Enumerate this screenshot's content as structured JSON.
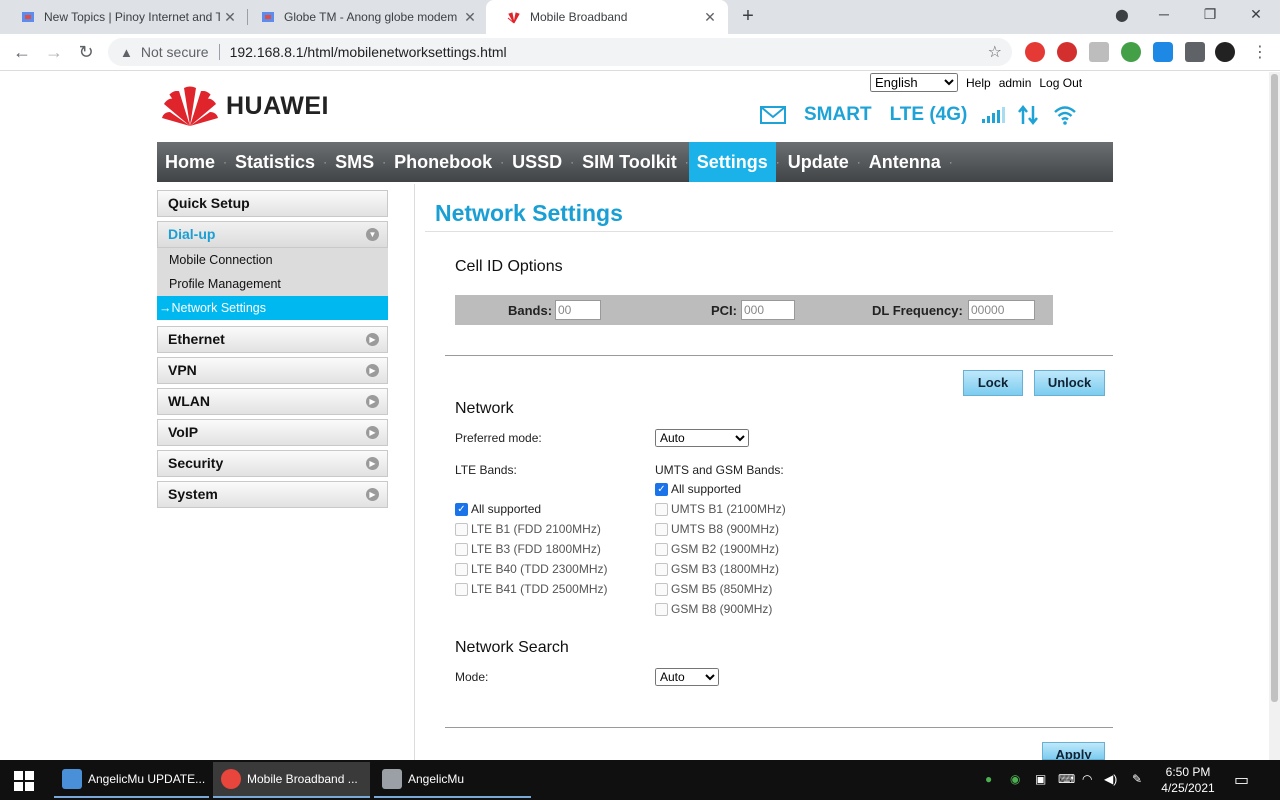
{
  "browser": {
    "tabs": [
      {
        "title": "New Topics | Pinoy Internet and T"
      },
      {
        "title": "Globe TM - Anong globe modem"
      },
      {
        "title": "Mobile Broadband"
      }
    ],
    "address": {
      "security": "Not secure",
      "url": "192.168.8.1/html/mobilenetworksettings.html"
    }
  },
  "header": {
    "language": "English",
    "help": "Help",
    "user": "admin",
    "logout": "Log Out",
    "brand": "HUAWEI",
    "operator": "SMART",
    "network_type": "LTE (4G)"
  },
  "nav": [
    "Home",
    "Statistics",
    "SMS",
    "Phonebook",
    "USSD",
    "SIM Toolkit",
    "Settings",
    "Update",
    "Antenna"
  ],
  "sidebar": {
    "quick_setup": "Quick Setup",
    "dialup": "Dial-up",
    "dialup_items": [
      "Mobile Connection",
      "Profile Management",
      "→Network Settings"
    ],
    "sections": [
      "Ethernet",
      "VPN",
      "WLAN",
      "VoIP",
      "Security",
      "System"
    ]
  },
  "page": {
    "title": "Network Settings",
    "cell_id_title": "Cell ID Options",
    "bands_label": "Bands:",
    "bands_value": "00",
    "pci_label": "PCI:",
    "pci_value": "000",
    "dl_label": "DL Frequency:",
    "dl_value": "00000",
    "lock": "Lock",
    "unlock": "Unlock",
    "network_title": "Network",
    "preferred_label": "Preferred mode:",
    "preferred_value": "Auto",
    "lte_label": "LTE Bands:",
    "umts_label": "UMTS and GSM Bands:",
    "lte_bands": [
      "All supported",
      "LTE B1 (FDD 2100MHz)",
      "LTE B3 (FDD 1800MHz)",
      "LTE B40 (TDD 2300MHz)",
      "LTE B41 (TDD 2500MHz)"
    ],
    "umts_bands": [
      "All supported",
      "UMTS B1 (2100MHz)",
      "UMTS B8 (900MHz)",
      "GSM B2 (1900MHz)",
      "GSM B3 (1800MHz)",
      "GSM B5 (850MHz)",
      "GSM B8 (900MHz)"
    ],
    "search_title": "Network Search",
    "mode_label": "Mode:",
    "mode_value": "Auto",
    "apply": "Apply"
  },
  "taskbar": {
    "apps": [
      "AngelicMu UPDATE...",
      "Mobile Broadband ...",
      "AngelicMu"
    ],
    "time": "6:50 PM",
    "date": "4/25/2021"
  },
  "colors": {
    "accent": "#1ab2e8",
    "heading": "#1a9fd4",
    "nav_bg": "#505456"
  }
}
